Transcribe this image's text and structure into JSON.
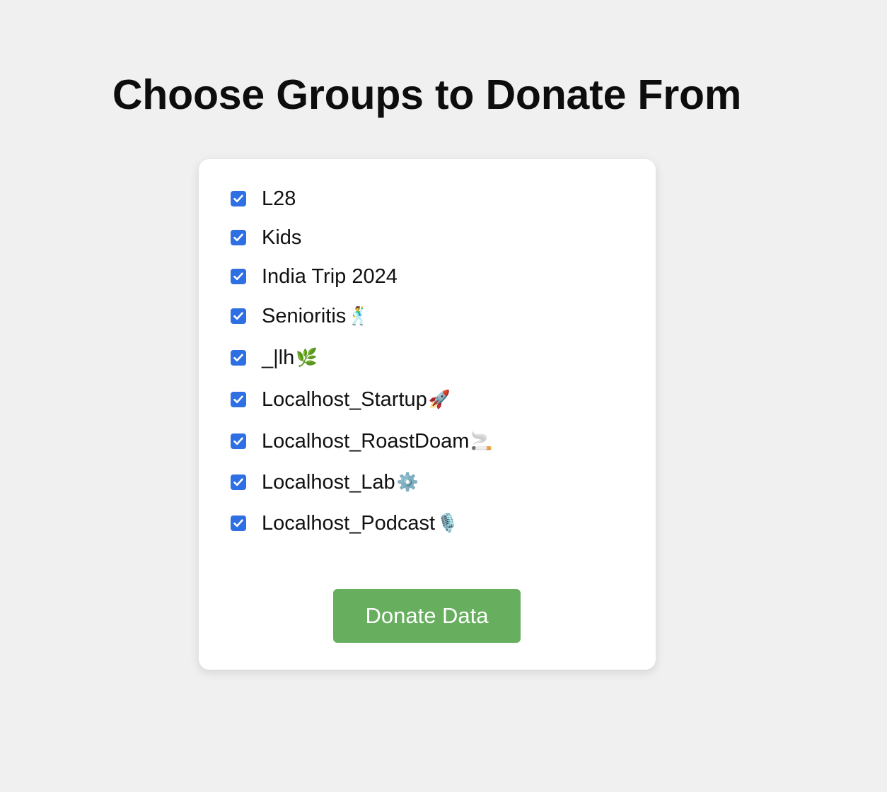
{
  "page": {
    "title": "Choose Groups to Donate From"
  },
  "groups": {
    "items": [
      {
        "label": "L28",
        "emoji": "",
        "checked": true
      },
      {
        "label": "Kids",
        "emoji": "",
        "checked": true
      },
      {
        "label": "India Trip 2024",
        "emoji": "",
        "checked": true
      },
      {
        "label": "Senioritis",
        "emoji": "🕺",
        "checked": true
      },
      {
        "label": "_|lh",
        "emoji": "🌿",
        "checked": true
      },
      {
        "label": "Localhost_Startup",
        "emoji": "🚀",
        "checked": true
      },
      {
        "label": "Localhost_RoastDoam",
        "emoji": "🚬",
        "checked": true
      },
      {
        "label": "Localhost_Lab",
        "emoji": "⚙️",
        "checked": true
      },
      {
        "label": "Localhost_Podcast",
        "emoji": "🎙️",
        "checked": true
      }
    ]
  },
  "actions": {
    "donate_label": "Donate Data"
  },
  "colors": {
    "background": "#f0f0f0",
    "card": "#ffffff",
    "checkbox_accent": "#2f6fe4",
    "button": "#67ae5e",
    "button_text": "#ffffff"
  },
  "icons": {
    "checkbox": "checkmark-icon"
  }
}
